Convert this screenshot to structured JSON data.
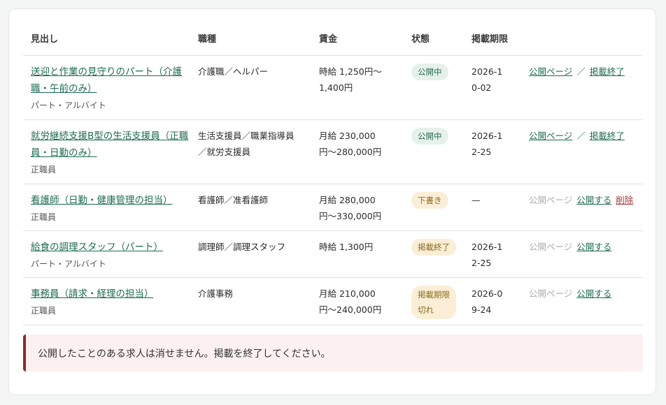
{
  "table": {
    "headers": [
      "見出し",
      "職種",
      "賃金",
      "状態",
      "掲載期限",
      ""
    ],
    "rows": [
      {
        "title": "送迎と作業の見守りのパート（介護職・午前のみ）",
        "employment": "パート・アルバイト",
        "job": "介護職／ヘルパー",
        "wage": "時給 1,250円〜1,400円",
        "status": "公開中",
        "status_type": "open",
        "deadline": "2026-10-02",
        "actions": [
          {
            "label": "公開ページ",
            "type": "link"
          },
          {
            "label": "／",
            "type": "sep"
          },
          {
            "label": "掲載終了",
            "type": "link"
          }
        ]
      },
      {
        "title": "就労継続支援B型の生活支援員（正職員・日勤のみ）",
        "employment": "正職員",
        "job": "生活支援員／職業指導員／就労支援員",
        "wage": "月給 230,000円〜280,000円",
        "status": "公開中",
        "status_type": "open",
        "deadline": "2026-12-25",
        "actions": [
          {
            "label": "公開ページ",
            "type": "link"
          },
          {
            "label": "／",
            "type": "sep"
          },
          {
            "label": "掲載終了",
            "type": "link"
          }
        ]
      },
      {
        "title": "看護師（日勤・健康管理の担当）",
        "employment": "正職員",
        "job": "看護師／准看護師",
        "wage": "月給 280,000円〜330,000円",
        "status": "下書き",
        "status_type": "draft",
        "deadline": "—",
        "actions": [
          {
            "label": "公開ページ",
            "type": "disabled"
          },
          {
            "label": "公開する",
            "type": "link"
          },
          {
            "label": "削除",
            "type": "delete"
          }
        ]
      },
      {
        "title": "給食の調理スタッフ（パート）",
        "employment": "パート・アルバイト",
        "job": "調理師／調理スタッフ",
        "wage": "時給 1,300円",
        "status": "掲載終了",
        "status_type": "end",
        "deadline": "2026-12-25",
        "actions": [
          {
            "label": "公開ページ",
            "type": "disabled"
          },
          {
            "label": "公開する",
            "type": "link"
          }
        ]
      },
      {
        "title": "事務員（請求・経理の担当）",
        "employment": "正職員",
        "job": "介護事務",
        "wage": "月給 210,000円〜240,000円",
        "status": "掲載期限切れ",
        "status_type": "exp",
        "deadline": "2026-09-24",
        "actions": [
          {
            "label": "公開ページ",
            "type": "disabled"
          },
          {
            "label": "公開する",
            "type": "link"
          }
        ]
      }
    ]
  },
  "notice": "公開したことのある求人は消せません。掲載を終了してください。"
}
